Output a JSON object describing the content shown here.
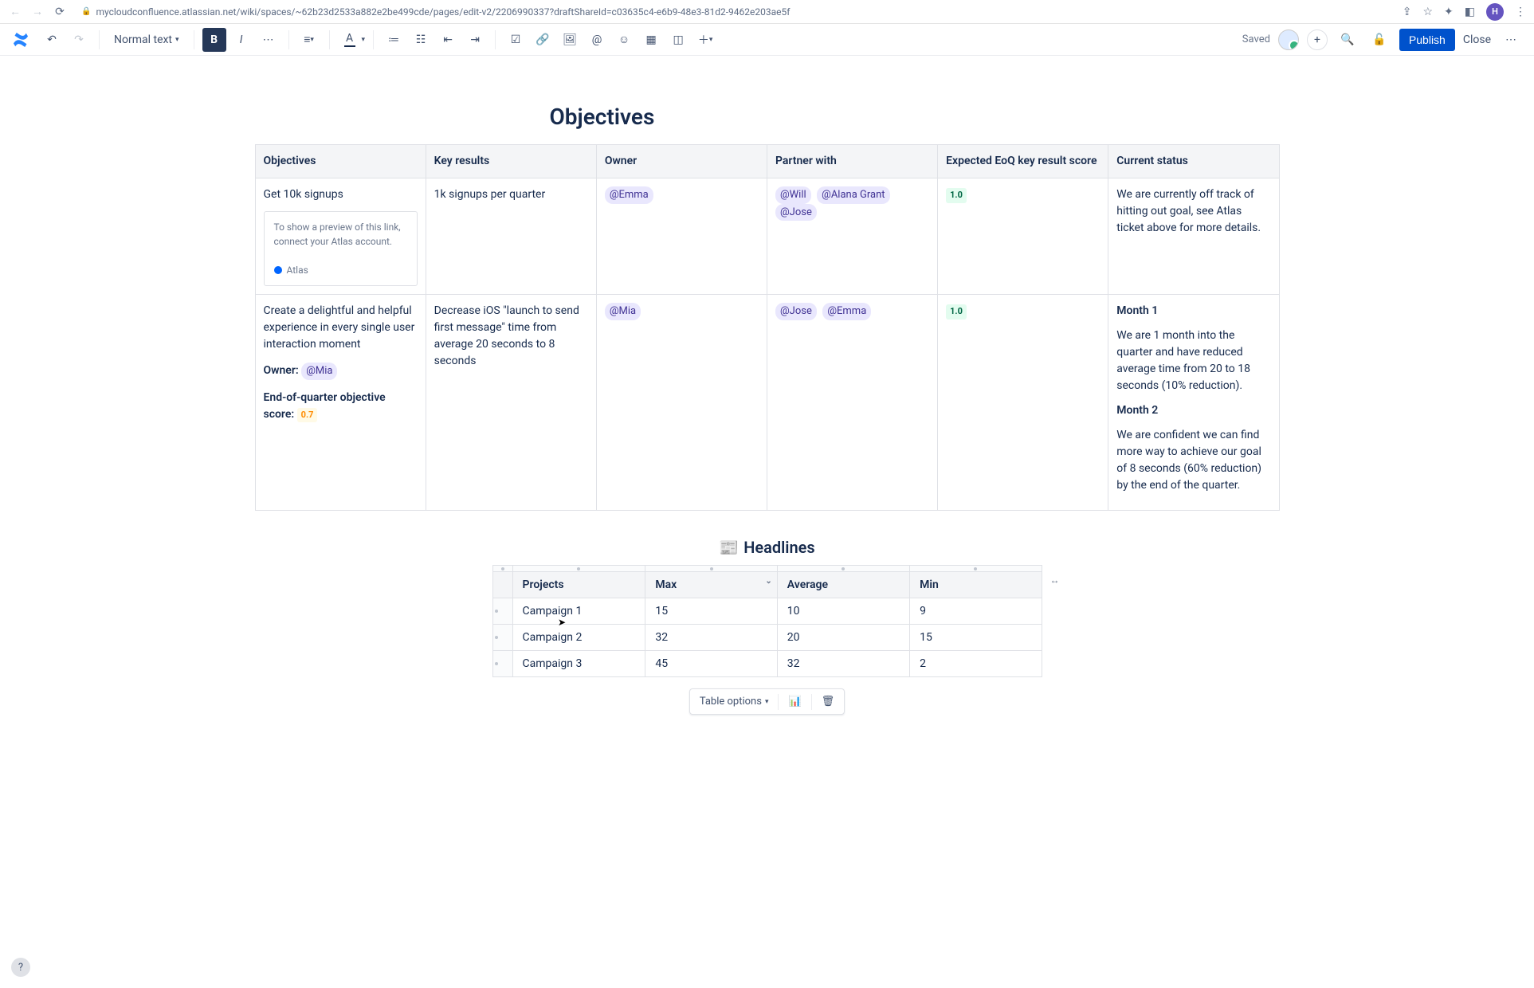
{
  "browser": {
    "url": "mycloudconfluence.atlassian.net/wiki/spaces/~62b23d2533a882e2be499cde/pages/edit-v2/2206990337?draftShareId=c03635c4-e6b9-48e3-81d2-9462e203ae5f",
    "avatar_initial": "H"
  },
  "toolbar": {
    "text_style": "Normal text",
    "saved": "Saved",
    "publish": "Publish",
    "close": "Close"
  },
  "page": {
    "title": "Objectives",
    "headlines_title": "Headlines",
    "headlines_emoji": "📰"
  },
  "objectives_headers": [
    "Objectives",
    "Key results",
    "Owner",
    "Partner with",
    "Expected EoQ key result score",
    "Current status"
  ],
  "objectives_rows": [
    {
      "objective": "Get 10k signups",
      "smartlink_prompt": "To show a preview of this link, connect your Atlas account.",
      "smartlink_app": "Atlas",
      "key_result": "1k signups per quarter",
      "owner": [
        "@Emma"
      ],
      "partners": [
        "@Will",
        "@Alana Grant",
        "@Jose"
      ],
      "score": "1.0",
      "status": "We are currently off track of hitting out goal, see Atlas ticket above for more details."
    },
    {
      "objective": "Create a delightful and helpful experience in every single user interaction moment",
      "owner_label": "Owner:",
      "owner_inline": "@Mia",
      "eoq_label": "End-of-quarter objective score:",
      "eoq_score": "0.7",
      "key_result": "Decrease iOS \"launch to send first message\" time from average 20 seconds to 8 seconds",
      "owner": [
        "@Mia"
      ],
      "partners": [
        "@Jose",
        "@Emma"
      ],
      "score": "1.0",
      "status_m1_h": "Month 1",
      "status_m1": "We are 1 month into the quarter and have reduced average time from 20 to 18 seconds (10% reduction).",
      "status_m2_h": "Month 2",
      "status_m2": "We are confident we can find more way to achieve our goal of 8 seconds (60% reduction) by the end of the quarter."
    }
  ],
  "headlines_headers": [
    "Projects",
    "Max",
    "Average",
    "Min"
  ],
  "headlines_rows": [
    {
      "project": "Campaign 1",
      "max": "15",
      "avg": "10",
      "min": "9"
    },
    {
      "project": "Campaign 2",
      "max": "32",
      "avg": "20",
      "min": "15"
    },
    {
      "project": "Campaign 3",
      "max": "45",
      "avg": "32",
      "min": "2"
    }
  ],
  "table_toolbar": {
    "options": "Table options"
  }
}
